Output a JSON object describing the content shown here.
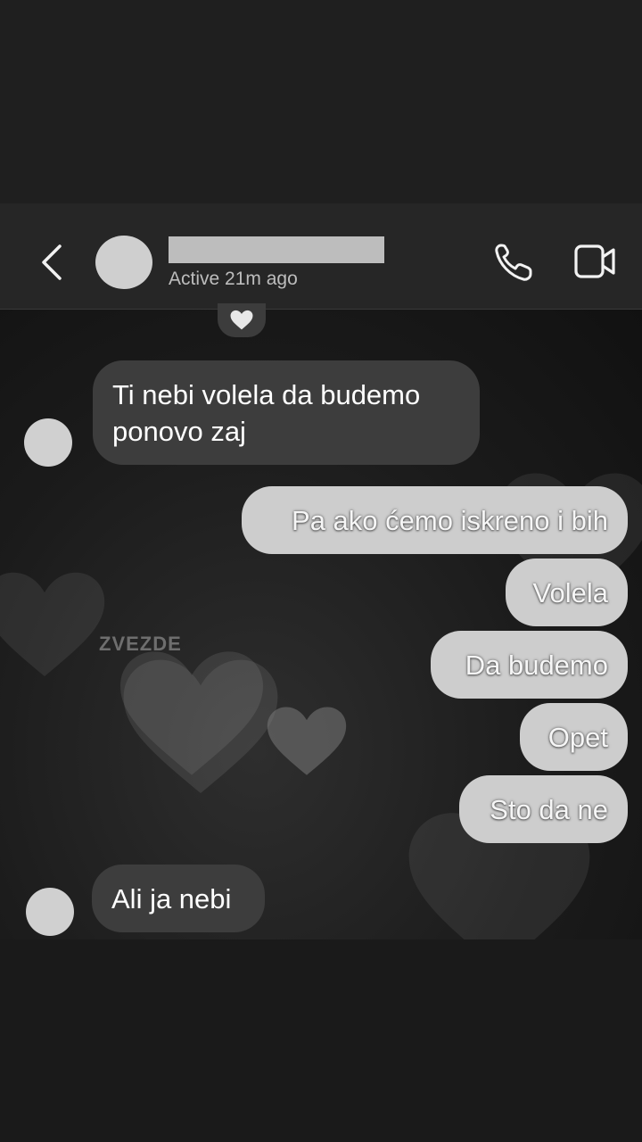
{
  "header": {
    "status": "Active 21m ago",
    "icons": {
      "back": "chevron-left-icon",
      "call": "phone-icon",
      "video": "video-camera-icon"
    }
  },
  "reaction": {
    "icon": "heart-icon"
  },
  "messages": [
    {
      "side": "received",
      "text": "Ti nebi volela da budemo ponovo zaj"
    },
    {
      "side": "sent",
      "text": "Pa ako ćemo iskreno i bih"
    },
    {
      "side": "sent",
      "text": "Volela"
    },
    {
      "side": "sent",
      "text": "Da budemo"
    },
    {
      "side": "sent",
      "text": "Opet"
    },
    {
      "side": "sent",
      "text": "Sto da ne"
    },
    {
      "side": "received",
      "text": "Ali ja nebi"
    }
  ],
  "watermark": "ZVEZDE",
  "colors": {
    "received_bubble": "#3d3d3d",
    "sent_bubble": "#cdcdcd",
    "header_bg": "#262626"
  }
}
